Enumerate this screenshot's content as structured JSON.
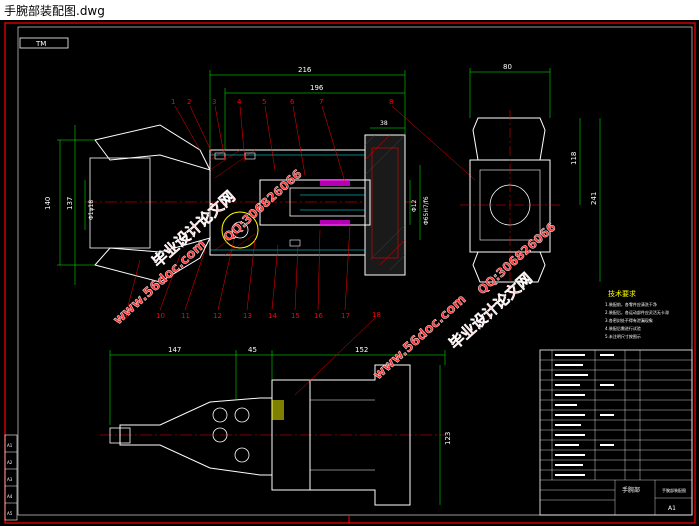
{
  "window": {
    "title": "手腕部装配图.dwg"
  },
  "drawing": {
    "top_tag": "TM",
    "dims_front": {
      "overall": "216",
      "mid": "196",
      "small": "38",
      "left_height": "140",
      "inner_height": "137",
      "bore": "Φ1φ18",
      "ri1": "Φ12",
      "ri2": "Φ65H7/f6"
    },
    "dims_side": {
      "width": "80",
      "h1": "118",
      "h2": "241"
    },
    "dims_bottom": {
      "d1": "147",
      "d2": "45",
      "d3": "152",
      "height": "123"
    },
    "balloons_top": [
      "1",
      "2",
      "3",
      "4",
      "5",
      "6",
      "7",
      "8"
    ],
    "balloons_bottom": [
      "9",
      "10",
      "11",
      "12",
      "13",
      "14",
      "15",
      "16",
      "17"
    ],
    "balloon_18": "18",
    "tech_title": "技术要求",
    "tech_notes": [
      "1.装配前，各零件应清洗干净",
      "2.装配后，各运动部件应灵活无卡滞",
      "3.各密封处不得有泄漏现象",
      "4.装配后需进行试验",
      "5.未注明尺寸按图示"
    ],
    "title_block": {
      "name": "手腕部",
      "scale": "A1",
      "label": "手腕部装配图"
    },
    "left_strip": [
      "A1",
      "A2",
      "A3",
      "A4",
      "A5"
    ]
  },
  "watermarks": {
    "mark1": "毕业设计论文网",
    "mark2": "www.56doc.com",
    "mark3": "QQ:306826066"
  },
  "colors": {
    "background": "#000000",
    "frame": "#ff0000",
    "line": "#ffffff",
    "dim": "#00ff00",
    "balloon": "#ff0000",
    "watermark": "#ff0000",
    "centerline": "#ff0000"
  }
}
